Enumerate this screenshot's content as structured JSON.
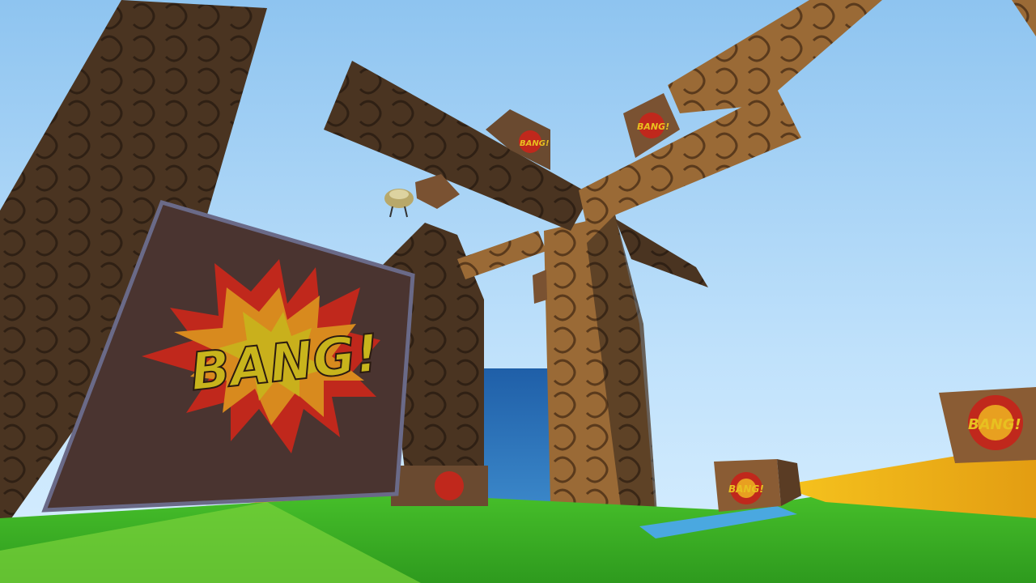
{
  "scene": {
    "type": "3d-platformer-level",
    "sky_color": "#a9d6f7",
    "ground_color": "#3fb82a",
    "path_color": "#f2b51a",
    "wood_color": "#6b4a2a",
    "water_color": "#2d6fb0"
  },
  "crates": {
    "label": "BANG!",
    "burst_outer_color": "#c0281c",
    "burst_inner_color": "#e8a020",
    "text_color": "#c8b41c"
  }
}
